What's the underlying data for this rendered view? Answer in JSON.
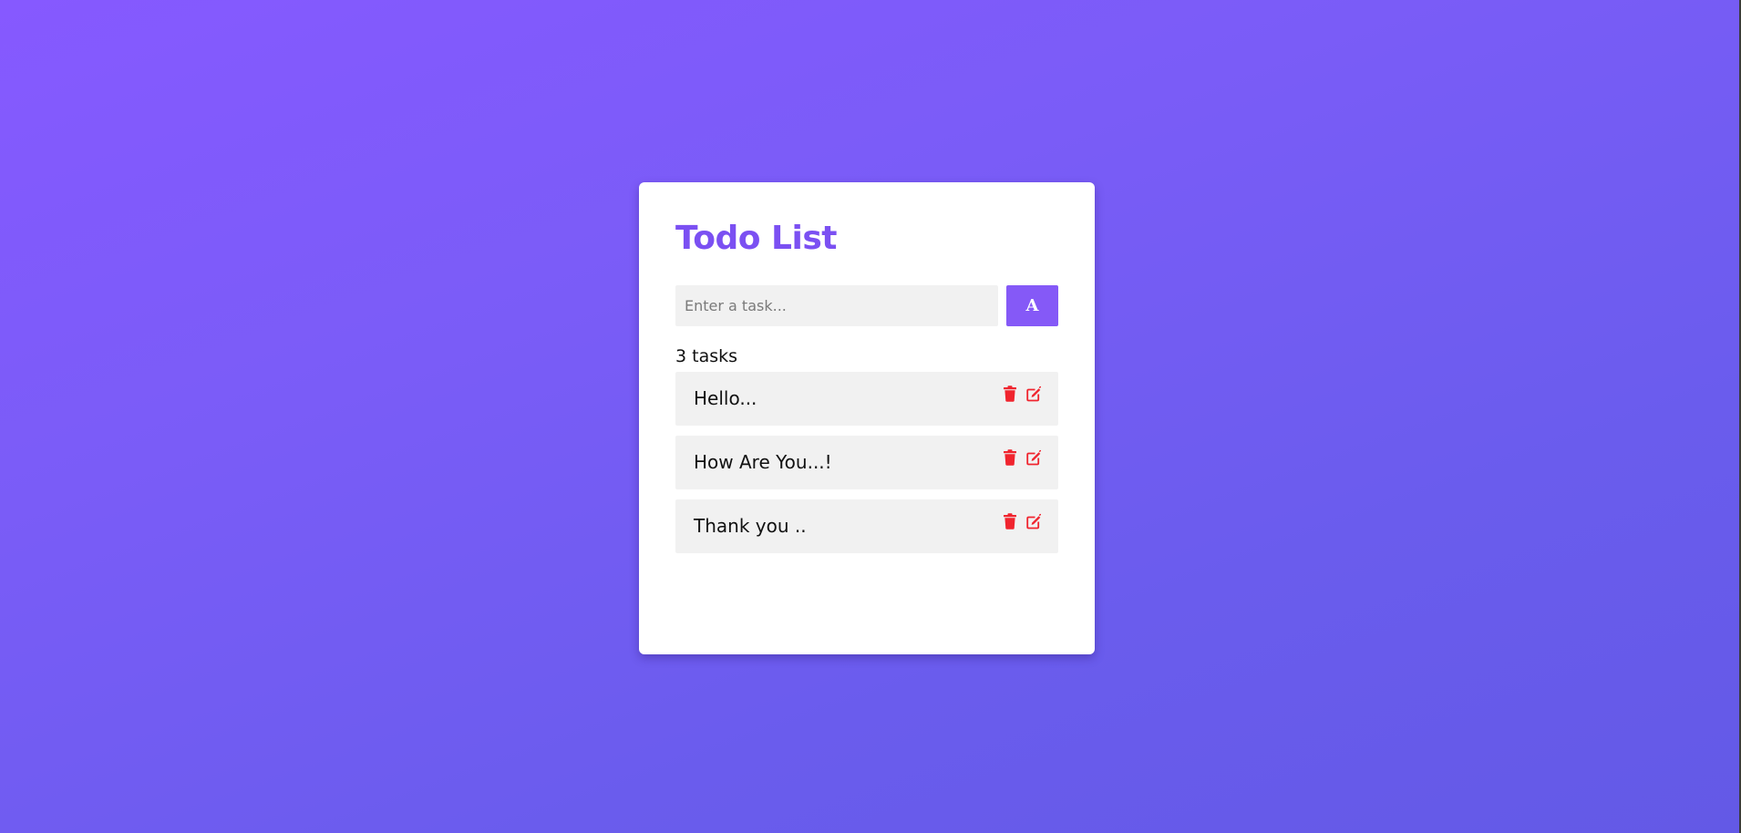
{
  "app": {
    "title": "Todo List"
  },
  "input": {
    "placeholder": "Enter a task...",
    "value": ""
  },
  "add_button": {
    "label": "A"
  },
  "task_count": "3 tasks",
  "tasks": [
    {
      "text": "Hello...",
      "delete_icon": "trash-icon",
      "edit_icon": "edit-icon"
    },
    {
      "text": "How Are You...!",
      "delete_icon": "trash-icon",
      "edit_icon": "edit-icon"
    },
    {
      "text": "Thank you ..",
      "delete_icon": "trash-icon",
      "edit_icon": "edit-icon"
    }
  ],
  "colors": {
    "accent": "#8559f7",
    "title": "#7b50f2",
    "icon_red": "#f0242e",
    "item_bg": "#f1f1f1",
    "bg_gradient_start": "#8659ff",
    "bg_gradient_end": "#6359e6"
  }
}
